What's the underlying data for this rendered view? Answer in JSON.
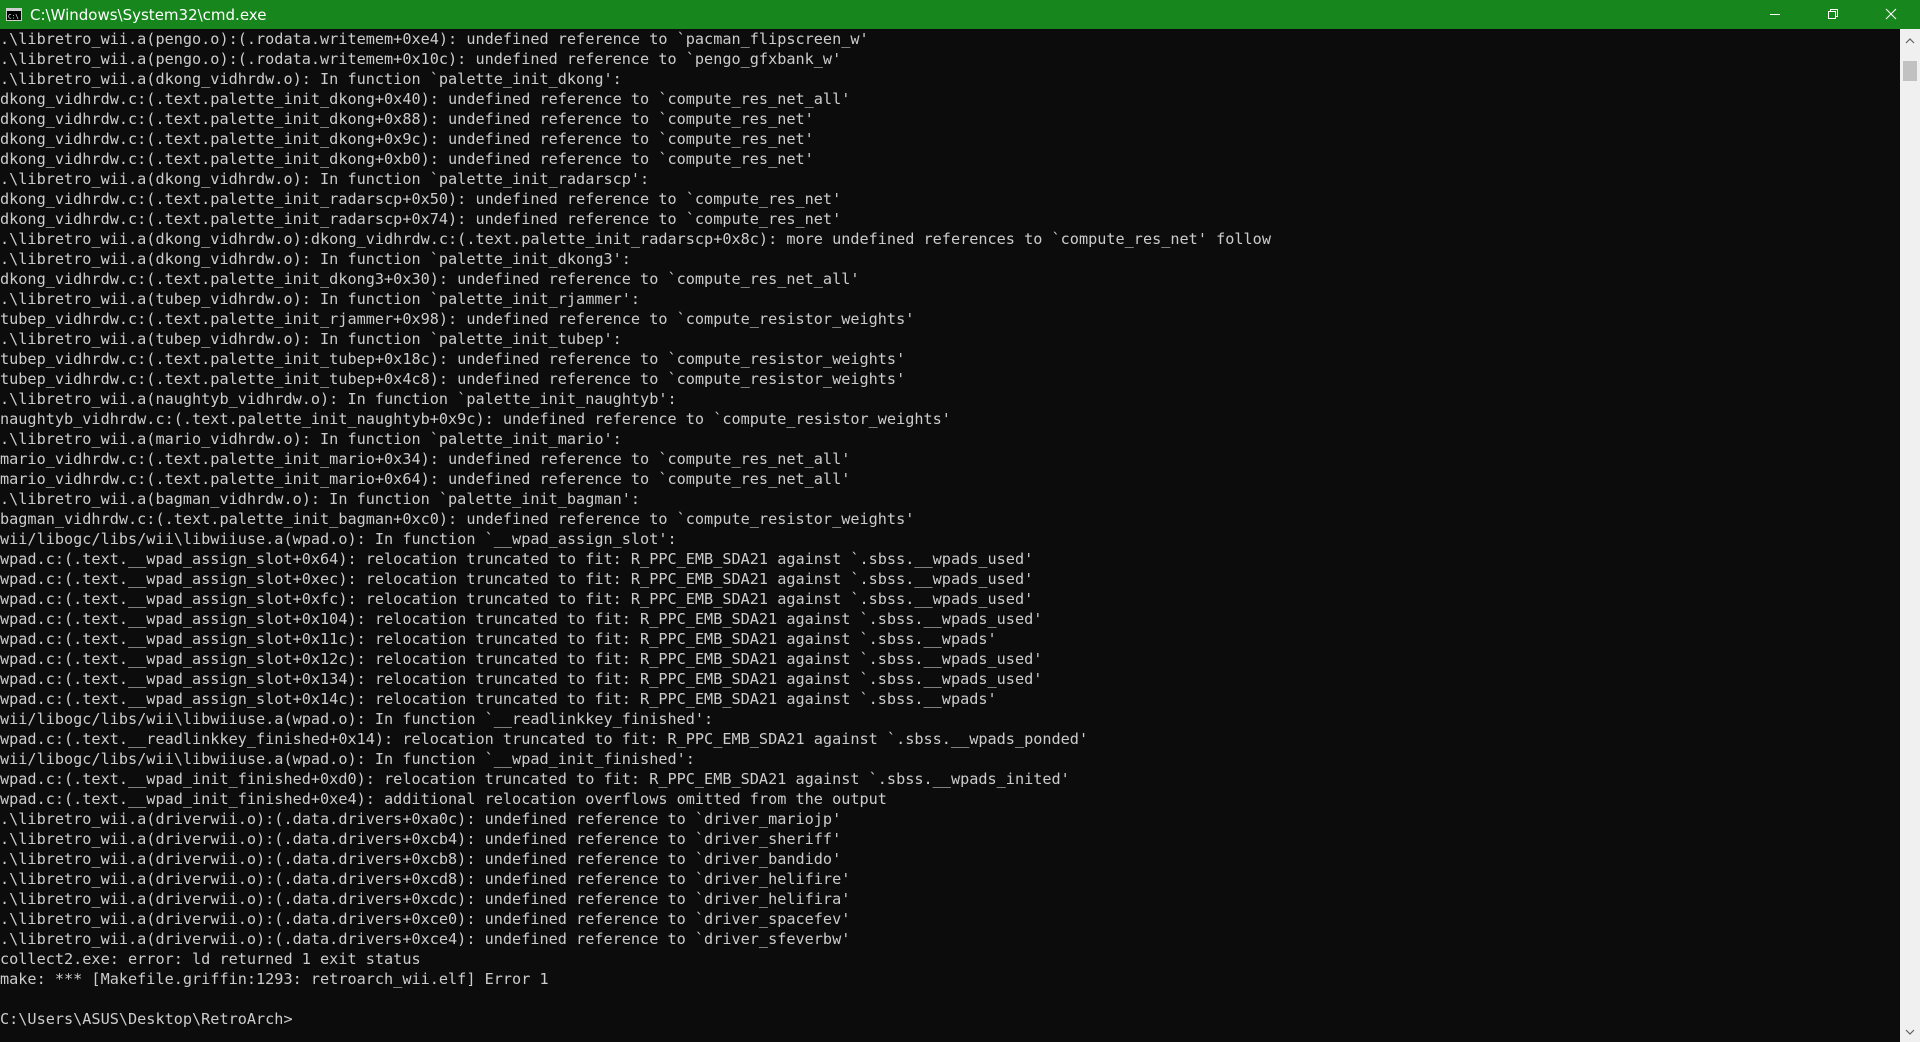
{
  "window": {
    "title": "C:\\Windows\\System32\\cmd.exe",
    "app_icon": "cmd-icon",
    "controls": {
      "minimize_icon": "minimize-icon",
      "maximize_icon": "restore-icon",
      "close_icon": "close-icon"
    },
    "colors": {
      "titlebar": "#17871d",
      "console_bg": "#0c0c0c",
      "console_fg": "#cccccc"
    }
  },
  "console": {
    "lines": [
      ".\\libretro_wii.a(pengo.o):(.rodata.writemem+0xe4): undefined reference to `pacman_flipscreen_w'",
      ".\\libretro_wii.a(pengo.o):(.rodata.writemem+0x10c): undefined reference to `pengo_gfxbank_w'",
      ".\\libretro_wii.a(dkong_vidhrdw.o): In function `palette_init_dkong':",
      "dkong_vidhrdw.c:(.text.palette_init_dkong+0x40): undefined reference to `compute_res_net_all'",
      "dkong_vidhrdw.c:(.text.palette_init_dkong+0x88): undefined reference to `compute_res_net'",
      "dkong_vidhrdw.c:(.text.palette_init_dkong+0x9c): undefined reference to `compute_res_net'",
      "dkong_vidhrdw.c:(.text.palette_init_dkong+0xb0): undefined reference to `compute_res_net'",
      ".\\libretro_wii.a(dkong_vidhrdw.o): In function `palette_init_radarscp':",
      "dkong_vidhrdw.c:(.text.palette_init_radarscp+0x50): undefined reference to `compute_res_net'",
      "dkong_vidhrdw.c:(.text.palette_init_radarscp+0x74): undefined reference to `compute_res_net'",
      ".\\libretro_wii.a(dkong_vidhrdw.o):dkong_vidhrdw.c:(.text.palette_init_radarscp+0x8c): more undefined references to `compute_res_net' follow",
      ".\\libretro_wii.a(dkong_vidhrdw.o): In function `palette_init_dkong3':",
      "dkong_vidhrdw.c:(.text.palette_init_dkong3+0x30): undefined reference to `compute_res_net_all'",
      ".\\libretro_wii.a(tubep_vidhrdw.o): In function `palette_init_rjammer':",
      "tubep_vidhrdw.c:(.text.palette_init_rjammer+0x98): undefined reference to `compute_resistor_weights'",
      ".\\libretro_wii.a(tubep_vidhrdw.o): In function `palette_init_tubep':",
      "tubep_vidhrdw.c:(.text.palette_init_tubep+0x18c): undefined reference to `compute_resistor_weights'",
      "tubep_vidhrdw.c:(.text.palette_init_tubep+0x4c8): undefined reference to `compute_resistor_weights'",
      ".\\libretro_wii.a(naughtyb_vidhrdw.o): In function `palette_init_naughtyb':",
      "naughtyb_vidhrdw.c:(.text.palette_init_naughtyb+0x9c): undefined reference to `compute_resistor_weights'",
      ".\\libretro_wii.a(mario_vidhrdw.o): In function `palette_init_mario':",
      "mario_vidhrdw.c:(.text.palette_init_mario+0x34): undefined reference to `compute_res_net_all'",
      "mario_vidhrdw.c:(.text.palette_init_mario+0x64): undefined reference to `compute_res_net_all'",
      ".\\libretro_wii.a(bagman_vidhrdw.o): In function `palette_init_bagman':",
      "bagman_vidhrdw.c:(.text.palette_init_bagman+0xc0): undefined reference to `compute_resistor_weights'",
      "wii/libogc/libs/wii\\libwiiuse.a(wpad.o): In function `__wpad_assign_slot':",
      "wpad.c:(.text.__wpad_assign_slot+0x64): relocation truncated to fit: R_PPC_EMB_SDA21 against `.sbss.__wpads_used'",
      "wpad.c:(.text.__wpad_assign_slot+0xec): relocation truncated to fit: R_PPC_EMB_SDA21 against `.sbss.__wpads_used'",
      "wpad.c:(.text.__wpad_assign_slot+0xfc): relocation truncated to fit: R_PPC_EMB_SDA21 against `.sbss.__wpads_used'",
      "wpad.c:(.text.__wpad_assign_slot+0x104): relocation truncated to fit: R_PPC_EMB_SDA21 against `.sbss.__wpads_used'",
      "wpad.c:(.text.__wpad_assign_slot+0x11c): relocation truncated to fit: R_PPC_EMB_SDA21 against `.sbss.__wpads'",
      "wpad.c:(.text.__wpad_assign_slot+0x12c): relocation truncated to fit: R_PPC_EMB_SDA21 against `.sbss.__wpads_used'",
      "wpad.c:(.text.__wpad_assign_slot+0x134): relocation truncated to fit: R_PPC_EMB_SDA21 against `.sbss.__wpads_used'",
      "wpad.c:(.text.__wpad_assign_slot+0x14c): relocation truncated to fit: R_PPC_EMB_SDA21 against `.sbss.__wpads'",
      "wii/libogc/libs/wii\\libwiiuse.a(wpad.o): In function `__readlinkkey_finished':",
      "wpad.c:(.text.__readlinkkey_finished+0x14): relocation truncated to fit: R_PPC_EMB_SDA21 against `.sbss.__wpads_ponded'",
      "wii/libogc/libs/wii\\libwiiuse.a(wpad.o): In function `__wpad_init_finished':",
      "wpad.c:(.text.__wpad_init_finished+0xd0): relocation truncated to fit: R_PPC_EMB_SDA21 against `.sbss.__wpads_inited'",
      "wpad.c:(.text.__wpad_init_finished+0xe4): additional relocation overflows omitted from the output",
      ".\\libretro_wii.a(driverwii.o):(.data.drivers+0xa0c): undefined reference to `driver_mariojp'",
      ".\\libretro_wii.a(driverwii.o):(.data.drivers+0xcb4): undefined reference to `driver_sheriff'",
      ".\\libretro_wii.a(driverwii.o):(.data.drivers+0xcb8): undefined reference to `driver_bandido'",
      ".\\libretro_wii.a(driverwii.o):(.data.drivers+0xcd8): undefined reference to `driver_helifire'",
      ".\\libretro_wii.a(driverwii.o):(.data.drivers+0xcdc): undefined reference to `driver_helifira'",
      ".\\libretro_wii.a(driverwii.o):(.data.drivers+0xce0): undefined reference to `driver_spacefev'",
      ".\\libretro_wii.a(driverwii.o):(.data.drivers+0xce4): undefined reference to `driver_sfeverbw'",
      "collect2.exe: error: ld returned 1 exit status",
      "make: *** [Makefile.griffin:1293: retroarch_wii.elf] Error 1",
      "",
      "C:\\Users\\ASUS\\Desktop\\RetroArch>"
    ]
  },
  "scrollbar": {
    "up_icon": "scroll-up-arrow-icon",
    "down_icon": "scroll-down-arrow-icon"
  }
}
